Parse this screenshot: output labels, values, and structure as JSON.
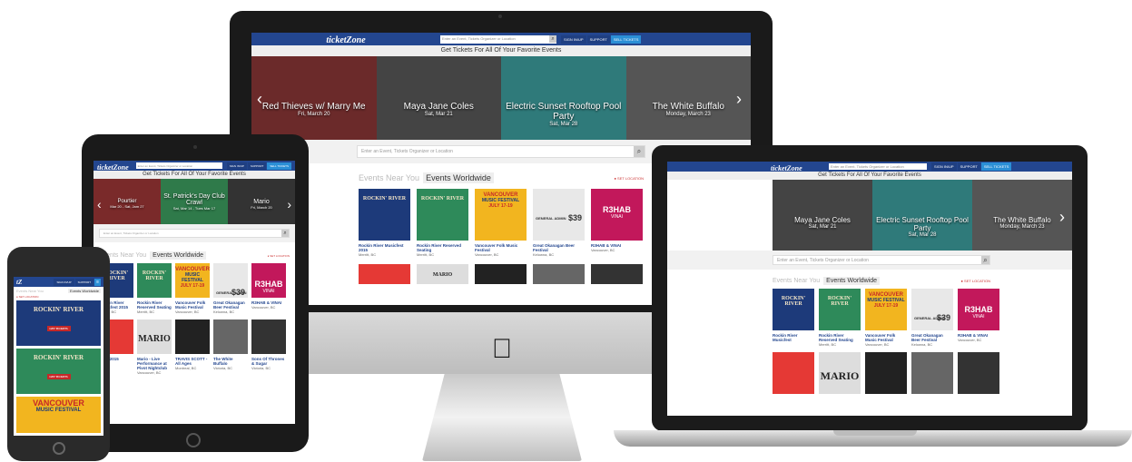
{
  "site": {
    "logo": "ticketZone",
    "logo_short": "tZ",
    "search_placeholder": "Enter an Event, Tickets Organizer or Location",
    "signup_label": "SIGN IN/UP",
    "support_label": "SUPPORT",
    "sell_label": "SELL TICKETS",
    "tagline": "Get Tickets For All Of Your Favorite Events",
    "brand_color": "#23468f",
    "sell_color": "#2b8fd6"
  },
  "carousel": [
    {
      "title": "Red Thieves w/ Marry Me",
      "date": "Fri, March 20",
      "bg": "#6b2a2a"
    },
    {
      "title": "Maya Jane Coles",
      "date": "Sat, Mar 21",
      "bg": "#444"
    },
    {
      "title": "Electric Sunset Rooftop Pool Party",
      "date": "Sat, Mar 28",
      "bg": "#2f7a7a"
    },
    {
      "title": "The White Buffalo",
      "date": "Monday, March 23",
      "bg": "#555"
    }
  ],
  "ipad_carousel": [
    {
      "title": "Pourtier",
      "date": "Mar 20 - Sat, Jam 27",
      "bg": "#7a2a2a"
    },
    {
      "title": "St. Patrick's Day Club Crawl",
      "date": "Sat, Mar 14 - Tues Mar 17",
      "bg": "#2f7a4a"
    },
    {
      "title": "Mario",
      "date": "Fri, March 20",
      "bg": "#333"
    }
  ],
  "tabs": {
    "near": "Events Near You",
    "worldwide": "Events Worldwide",
    "location": "SET LOCATION"
  },
  "events": [
    {
      "title": "Rockin River Musicfest 2015",
      "venue": "Merritt, BC",
      "bg": "#1d3a7a"
    },
    {
      "title": "Rockin River Reserved Seating",
      "venue": "Merritt, BC",
      "bg": "#2e8a5a"
    },
    {
      "title": "Vancouver Folk Music Festival",
      "venue": "Vancouver, BC",
      "bg": "#f2b51f"
    },
    {
      "title": "Great Okanagan Beer Festival",
      "venue": "Kelowna, BC",
      "bg": "#e8e8e8"
    },
    {
      "title": "R3HAB & VINAI",
      "venue": "Vancouver, BC",
      "bg": "#c2185b"
    }
  ],
  "events_row2": [
    {
      "bg": "#e53935"
    },
    {
      "bg": "#ddd"
    },
    {
      "bg": "#222"
    },
    {
      "bg": "#666"
    },
    {
      "bg": "#333"
    }
  ],
  "laptop_events": [
    {
      "title": "Rockin River Musicfest",
      "venue": "",
      "bg": "#1d3a7a"
    },
    {
      "title": "Rockin River Reserved Seating",
      "venue": "Merritt, BC",
      "bg": "#2e8a5a"
    },
    {
      "title": "Vancouver Folk Music Festival",
      "venue": "Vancouver, BC",
      "bg": "#f2b51f"
    },
    {
      "title": "Great Okanagan Beer Festival",
      "venue": "Kelowna, BC",
      "bg": "#e8e8e8"
    },
    {
      "title": "R3HAB & VINAI",
      "venue": "Vancouver, BC",
      "bg": "#c2185b"
    }
  ],
  "ipad_row2": [
    {
      "title": "...ust 2015",
      "venue": "",
      "bg": "#e53935"
    },
    {
      "title": "Mario - Live Performance at Pivot Nightclub",
      "venue": "Vancouver, BC",
      "bg": "#ddd"
    },
    {
      "title": "TRAVIS SCOTT - All Ages",
      "venue": "Montreal, BC",
      "bg": "#222"
    },
    {
      "title": "The White Buffalo",
      "venue": "Victoria, BC",
      "bg": "#666"
    },
    {
      "title": "Sons Of Thrones & Sugar",
      "venue": "Victoria, BC",
      "bg": "#333"
    }
  ],
  "poster_text": {
    "rockin": "ROCKIN' RIVER",
    "vancouver": "VANCOUVER",
    "folk": "MUSIC FESTIVAL",
    "folk_dates": "JULY 17-19",
    "beer": "GENERAL ADMIN",
    "beer_price": "$39",
    "r3hab": "R3HAB",
    "vinai": "VINAI",
    "mario": "MARIO",
    "get_tickets": "GET TICKETS"
  }
}
